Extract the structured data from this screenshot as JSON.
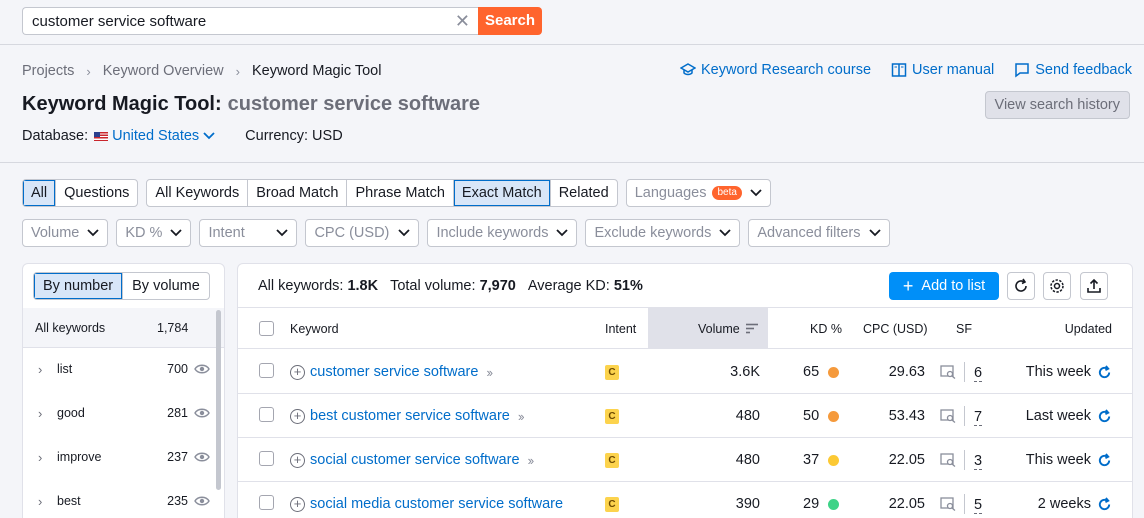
{
  "search": {
    "query": "customer service software",
    "button": "Search"
  },
  "breadcrumbs": [
    "Projects",
    "Keyword Overview",
    "Keyword Magic Tool"
  ],
  "links": {
    "course": "Keyword Research course",
    "manual": "User manual",
    "feedback": "Send feedback"
  },
  "title": {
    "tool": "Keyword Magic Tool:",
    "keyword": "customer service software"
  },
  "history_button": "View search history",
  "database": {
    "label": "Database:",
    "country": "United States",
    "currency": "Currency: USD"
  },
  "match_tabs": {
    "group1": [
      "All",
      "Questions"
    ],
    "group2": [
      "All Keywords",
      "Broad Match",
      "Phrase Match",
      "Exact Match",
      "Related"
    ]
  },
  "languages": {
    "label": "Languages",
    "badge": "beta"
  },
  "filters": [
    "Volume",
    "KD %",
    "Intent",
    "CPC (USD)",
    "Include keywords",
    "Exclude keywords",
    "Advanced filters"
  ],
  "left_panel": {
    "toggle": [
      "By number",
      "By volume"
    ],
    "header": {
      "label": "All keywords",
      "count": "1,784"
    },
    "groups": [
      {
        "label": "list",
        "count": "700"
      },
      {
        "label": "good",
        "count": "281"
      },
      {
        "label": "improve",
        "count": "237"
      },
      {
        "label": "best",
        "count": "235"
      }
    ]
  },
  "stats": {
    "all_label": "All keywords:",
    "all_value": "1.8K",
    "vol_label": "Total volume:",
    "vol_value": "7,970",
    "kd_label": "Average KD:",
    "kd_value": "51%"
  },
  "add_button": "Add to list",
  "columns": {
    "keyword": "Keyword",
    "intent": "Intent",
    "volume": "Volume",
    "kd": "KD %",
    "cpc": "CPC (USD)",
    "sf": "SF",
    "updated": "Updated"
  },
  "rows": [
    {
      "keyword": "customer service software",
      "intent": "C",
      "volume": "3.6K",
      "kd": "65",
      "kd_color": "#f59a3c",
      "cpc": "29.63",
      "sf": "6",
      "updated": "This week"
    },
    {
      "keyword": "best customer service software",
      "intent": "C",
      "volume": "480",
      "kd": "50",
      "kd_color": "#f59a3c",
      "cpc": "53.43",
      "sf": "7",
      "updated": "Last week"
    },
    {
      "keyword": "social customer service software",
      "intent": "C",
      "volume": "480",
      "kd": "37",
      "kd_color": "#fcc934",
      "cpc": "22.05",
      "sf": "3",
      "updated": "This week"
    },
    {
      "keyword": "social media customer service software",
      "intent": "C",
      "volume": "390",
      "kd": "29",
      "kd_color": "#3ed387",
      "cpc": "22.05",
      "sf": "5",
      "updated": "2 weeks"
    }
  ]
}
